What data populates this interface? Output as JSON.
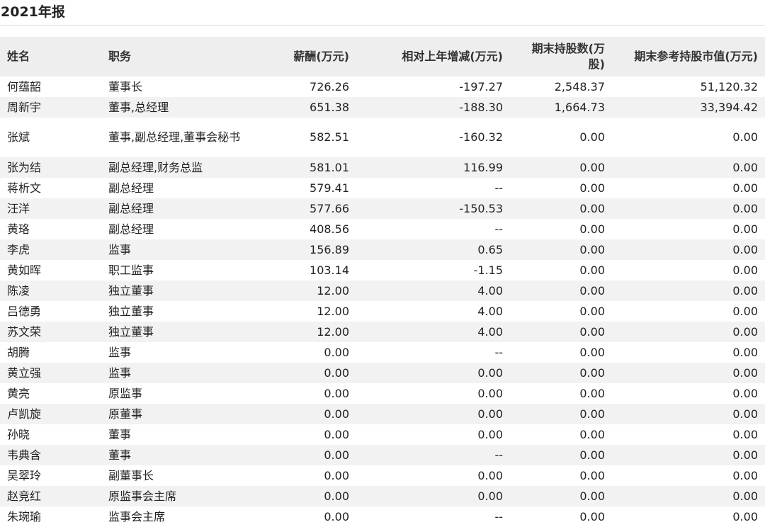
{
  "title": "2021年报",
  "headers": {
    "name": "姓名",
    "position": "职务",
    "salary": "薪酬(万元)",
    "change": "相对上年增减(万元)",
    "shares": "期末持股数(万股)",
    "market_value": "期末参考持股市值(万元)"
  },
  "rows": [
    {
      "name": "何蕴韶",
      "position": "董事长",
      "salary": "726.26",
      "change": "-197.27",
      "shares": "2,548.37",
      "market_value": "51,120.32"
    },
    {
      "name": "周新宇",
      "position": "董事,总经理",
      "salary": "651.38",
      "change": "-188.30",
      "shares": "1,664.73",
      "market_value": "33,394.42"
    },
    {
      "name": "张斌",
      "position": "董事,副总经理,董事会秘书",
      "salary": "582.51",
      "change": "-160.32",
      "shares": "0.00",
      "market_value": "0.00"
    },
    {
      "name": "张为结",
      "position": "副总经理,财务总监",
      "salary": "581.01",
      "change": "116.99",
      "shares": "0.00",
      "market_value": "0.00"
    },
    {
      "name": "蒋析文",
      "position": "副总经理",
      "salary": "579.41",
      "change": "--",
      "shares": "0.00",
      "market_value": "0.00"
    },
    {
      "name": "汪洋",
      "position": "副总经理",
      "salary": "577.66",
      "change": "-150.53",
      "shares": "0.00",
      "market_value": "0.00"
    },
    {
      "name": "黄珞",
      "position": "副总经理",
      "salary": "408.56",
      "change": "--",
      "shares": "0.00",
      "market_value": "0.00"
    },
    {
      "name": "李虎",
      "position": "监事",
      "salary": "156.89",
      "change": "0.65",
      "shares": "0.00",
      "market_value": "0.00"
    },
    {
      "name": "黄如晖",
      "position": "职工监事",
      "salary": "103.14",
      "change": "-1.15",
      "shares": "0.00",
      "market_value": "0.00"
    },
    {
      "name": "陈凌",
      "position": "独立董事",
      "salary": "12.00",
      "change": "4.00",
      "shares": "0.00",
      "market_value": "0.00"
    },
    {
      "name": "吕德勇",
      "position": "独立董事",
      "salary": "12.00",
      "change": "4.00",
      "shares": "0.00",
      "market_value": "0.00"
    },
    {
      "name": "苏文荣",
      "position": "独立董事",
      "salary": "12.00",
      "change": "4.00",
      "shares": "0.00",
      "market_value": "0.00"
    },
    {
      "name": "胡腾",
      "position": "监事",
      "salary": "0.00",
      "change": "--",
      "shares": "0.00",
      "market_value": "0.00"
    },
    {
      "name": "黄立强",
      "position": "监事",
      "salary": "0.00",
      "change": "0.00",
      "shares": "0.00",
      "market_value": "0.00"
    },
    {
      "name": "黄亮",
      "position": "原监事",
      "salary": "0.00",
      "change": "0.00",
      "shares": "0.00",
      "market_value": "0.00"
    },
    {
      "name": "卢凯旋",
      "position": "原董事",
      "salary": "0.00",
      "change": "0.00",
      "shares": "0.00",
      "market_value": "0.00"
    },
    {
      "name": "孙晓",
      "position": "董事",
      "salary": "0.00",
      "change": "0.00",
      "shares": "0.00",
      "market_value": "0.00"
    },
    {
      "name": "韦典含",
      "position": "董事",
      "salary": "0.00",
      "change": "--",
      "shares": "0.00",
      "market_value": "0.00"
    },
    {
      "name": "吴翠玲",
      "position": "副董事长",
      "salary": "0.00",
      "change": "0.00",
      "shares": "0.00",
      "market_value": "0.00"
    },
    {
      "name": "赵竞红",
      "position": "原监事会主席",
      "salary": "0.00",
      "change": "0.00",
      "shares": "0.00",
      "market_value": "0.00"
    },
    {
      "name": "朱琬瑜",
      "position": "监事会主席",
      "salary": "0.00",
      "change": "--",
      "shares": "0.00",
      "market_value": "0.00"
    }
  ]
}
